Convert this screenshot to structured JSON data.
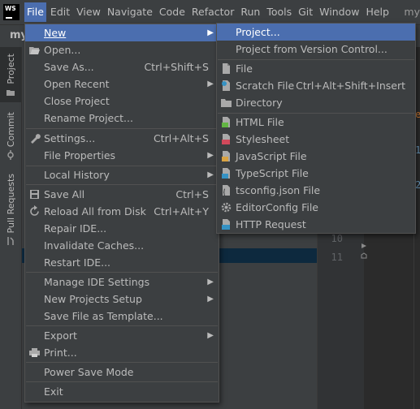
{
  "menubar": {
    "logo_text": "WS",
    "items": [
      "File",
      "Edit",
      "View",
      "Navigate",
      "Code",
      "Refactor",
      "Run",
      "Tools",
      "Git",
      "Window",
      "Help"
    ],
    "project_title": "my"
  },
  "navbar": {
    "crumb": "my"
  },
  "toolstrip": {
    "project": "Project",
    "commit": "Commit",
    "pull_requests": "Pull Requests"
  },
  "gutter": {
    "line_10": "10",
    "line_11": "11"
  },
  "edge_glyphs": {
    "e": "e",
    "one": "1",
    "two": "2"
  },
  "file_menu": {
    "new": "New",
    "open": "Open...",
    "save_as": "Save As...",
    "save_as_sc": "Ctrl+Shift+S",
    "open_recent": "Open Recent",
    "close_project": "Close Project",
    "rename_project": "Rename Project...",
    "settings": "Settings...",
    "settings_sc": "Ctrl+Alt+S",
    "file_properties": "File Properties",
    "local_history": "Local History",
    "save_all": "Save All",
    "save_all_sc": "Ctrl+S",
    "reload": "Reload All from Disk",
    "reload_sc": "Ctrl+Alt+Y",
    "repair_ide": "Repair IDE...",
    "invalidate": "Invalidate Caches...",
    "restart": "Restart IDE...",
    "manage_settings": "Manage IDE Settings",
    "new_project_setup": "New Projects Setup",
    "save_template": "Save File as Template...",
    "export": "Export",
    "print": "Print...",
    "power_save": "Power Save Mode",
    "exit": "Exit"
  },
  "new_menu": {
    "project": "Project...",
    "project_vcs": "Project from Version Control...",
    "file": "File",
    "scratch": "Scratch File",
    "scratch_sc": "Ctrl+Alt+Shift+Insert",
    "directory": "Directory",
    "html": "HTML File",
    "stylesheet": "Stylesheet",
    "javascript": "JavaScript File",
    "typescript": "TypeScript File",
    "tsconfig": "tsconfig.json File",
    "editorconfig": "EditorConfig File",
    "http": "HTTP Request"
  },
  "colors": {
    "accent": "#4b6eaf",
    "menu_bg": "#3c3f41",
    "editor_bg": "#2b2b2b"
  }
}
